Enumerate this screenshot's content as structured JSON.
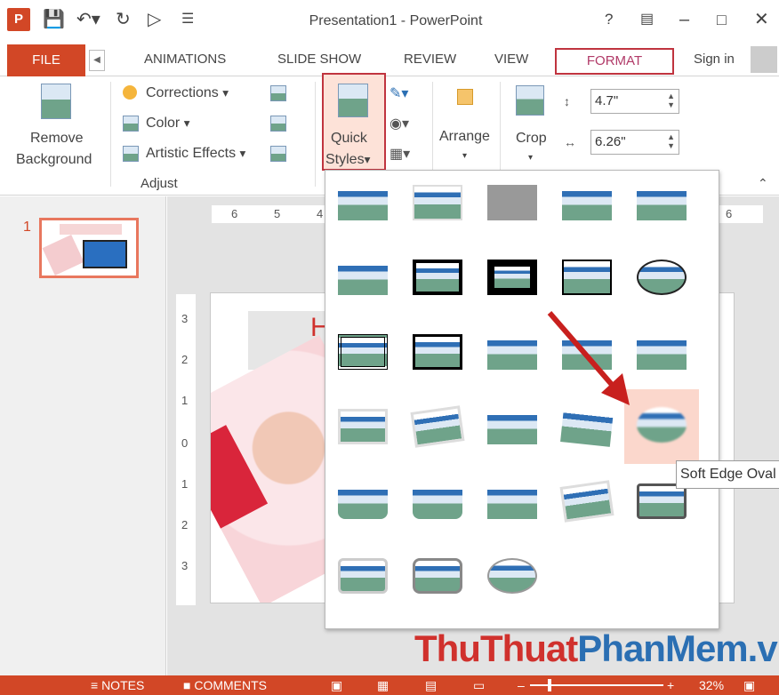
{
  "title_bar": {
    "title": "Presentation1 - PowerPoint",
    "help": "?",
    "app_icon": "P"
  },
  "tabs": {
    "file": "FILE",
    "items": [
      "ANIMATIONS",
      "SLIDE SHOW",
      "REVIEW",
      "VIEW"
    ],
    "format": "FORMAT",
    "sign_in": "Sign in"
  },
  "ribbon": {
    "remove_background": [
      "Remove",
      "Background"
    ],
    "corrections": "Corrections",
    "color": "Color",
    "artistic_effects": "Artistic Effects",
    "adjust_group": "Adjust",
    "quick_styles": [
      "Quick",
      "Styles"
    ],
    "arrange": "Arrange",
    "crop": "Crop",
    "height": "4.7\"",
    "width": "6.26\""
  },
  "slide_panel": {
    "slide_number": "1"
  },
  "ruler": {
    "h": [
      "6",
      "5",
      "4",
      "6"
    ],
    "v": [
      "3",
      "2",
      "1",
      "0",
      "1",
      "2",
      "3"
    ]
  },
  "slide": {
    "heading": "H"
  },
  "gallery": {
    "tooltip": "Soft Edge Oval"
  },
  "watermark": {
    "part1": "ThuThuat",
    "part2": "PhanMem",
    "part3": ".vn"
  },
  "status": {
    "notes": "NOTES",
    "comments": "COMMENTS",
    "zoom": "32%"
  },
  "colors": {
    "accent": "#d24726",
    "highlight": "#c0343f",
    "watermark_blue": "#2b6fb3",
    "watermark_red": "#d0312d"
  }
}
